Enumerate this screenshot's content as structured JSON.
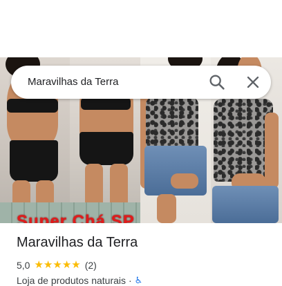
{
  "search": {
    "query": "Maravilhas da Terra"
  },
  "photo": {
    "watermark_text": "Super Chá SP"
  },
  "place": {
    "name": "Maravilhas da Terra",
    "rating": "5,0",
    "stars": [
      "★",
      "★",
      "★",
      "★",
      "★"
    ],
    "review_count": "(2)",
    "category": "Loja de produtos naturais",
    "separator": "·",
    "accessible_glyph": "♿"
  },
  "colors": {
    "star": "#fbbc04",
    "watermark": "#e01b1b",
    "accessibility": "#1a73e8"
  },
  "icons": [
    "search-icon",
    "close-icon",
    "star-icon",
    "wheelchair-accessible-icon"
  ]
}
